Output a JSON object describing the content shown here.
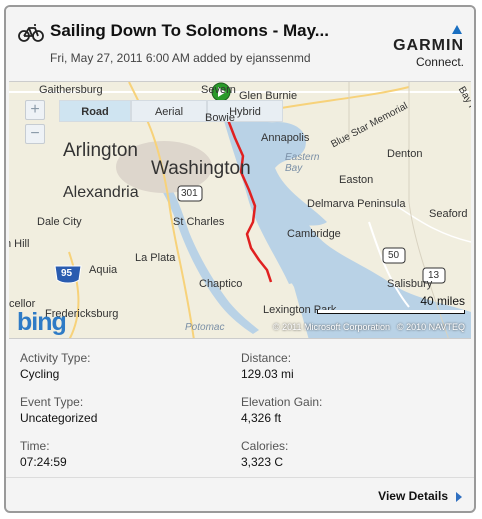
{
  "header": {
    "title": "Sailing Down To Solomons - May...",
    "subtitle": "Fri, May 27, 2011 6:00 AM added by ejanssenmd",
    "activity_icon": "bicycle-icon",
    "logo": {
      "brand": "GARMIN",
      "product": "Connect.",
      "accent_color": "#1a6fc1"
    }
  },
  "map": {
    "map_types": [
      "Road",
      "Aerial",
      "Hybrid"
    ],
    "active_map_type": "Road",
    "zoom_in": "+",
    "zoom_out": "−",
    "scale_label": "40 miles",
    "provider": "bing",
    "copyright_ms": "© 2011 Microsoft Corporation",
    "copyright_navteq": "© 2010 NAVTEQ",
    "route_color": "#e02020",
    "labels": {
      "gaithersburg": "Gaithersburg",
      "severn": "Severn",
      "glen_burnie": "Glen Burnie",
      "bowie": "Bowie",
      "annapolis": "Annapolis",
      "blue_star": "Blue Star Memorial",
      "arlington": "Arlington",
      "washington": "Washington",
      "alexandria": "Alexandria",
      "eastern_bay": "Eastern Bay",
      "denton": "Denton",
      "easton": "Easton",
      "delmarva": "Delmarva Peninsula",
      "seaford": "Seaford",
      "dale_city": "Dale City",
      "st_charles": "St Charles",
      "cambridge": "Cambridge",
      "la_plata": "La Plata",
      "aquia": "Aquia",
      "salisbury": "Salisbury",
      "chaptico": "Chaptico",
      "lexington_park": "Lexington Park",
      "fredericksburg": "Fredericksburg",
      "potomac": "Potomac",
      "bay_ridge": "Bay Ridge",
      "ellor": "cellor",
      "hill": "h Hill",
      "r301": "301",
      "r95": "95",
      "r50": "50",
      "r13": "13"
    }
  },
  "stats": {
    "activity_type_label": "Activity Type:",
    "activity_type": "Cycling",
    "event_type_label": "Event Type:",
    "event_type": "Uncategorized",
    "time_label": "Time:",
    "time": "07:24:59",
    "distance_label": "Distance:",
    "distance": "129.03 mi",
    "elevation_label": "Elevation Gain:",
    "elevation": "4,326 ft",
    "calories_label": "Calories:",
    "calories": "3,323 C"
  },
  "footer": {
    "view_details": "View Details"
  }
}
